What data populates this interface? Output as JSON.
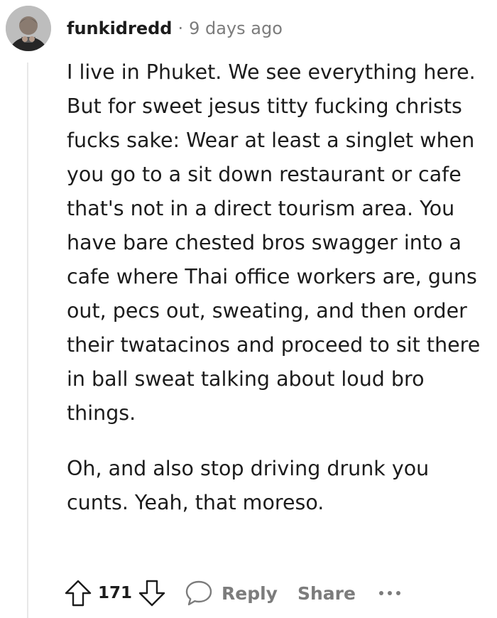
{
  "comment": {
    "username": "funkidredd",
    "separator": "·",
    "timestamp": "9 days ago",
    "paragraphs": [
      "I live in Phuket. We see everything here. But for sweet jesus titty fucking christs fucks sake: Wear at least a singlet when you go to a sit down restaurant or cafe that's not in a direct tourism area. You have bare chested bros swagger into a cafe where Thai office workers are, guns out, pecs out, sweating, and then order their twatacinos and proceed to sit there in ball sweat talking about loud bro things.",
      "Oh, and also stop driving drunk you cunts. Yeah, that moreso."
    ],
    "vote_count": "171",
    "reply_label": "Reply",
    "share_label": "Share"
  },
  "icons": {
    "avatar": "avatar-photo",
    "upvote": "upvote-arrow-icon",
    "downvote": "downvote-arrow-icon",
    "reply": "speech-bubble-icon",
    "more": "more-horizontal-icon"
  },
  "colors": {
    "text": "#1c1c1c",
    "muted": "#7c7c7c",
    "thread_line": "#e8e8e8"
  }
}
